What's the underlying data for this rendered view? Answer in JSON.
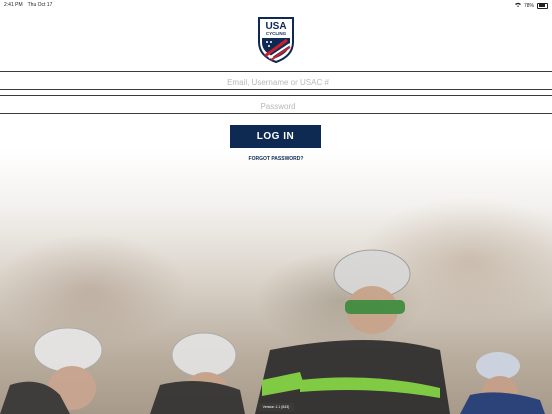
{
  "status_bar": {
    "time": "2:41 PM",
    "date": "Thu Oct 17",
    "battery": "78%"
  },
  "logo": {
    "text_top": "USA",
    "text_bottom": "CYCLING",
    "colors": {
      "navy": "#0f2a52",
      "red": "#c8202f"
    }
  },
  "login_form": {
    "username_placeholder": "Email, Username or USAC #",
    "password_placeholder": "Password",
    "login_label": "LOG IN",
    "forgot_label": "FORGOT PASSWORD?"
  },
  "footer": {
    "version": "Version 1.1 (843)"
  },
  "background": {
    "description_icon": "cyclists-photo"
  }
}
